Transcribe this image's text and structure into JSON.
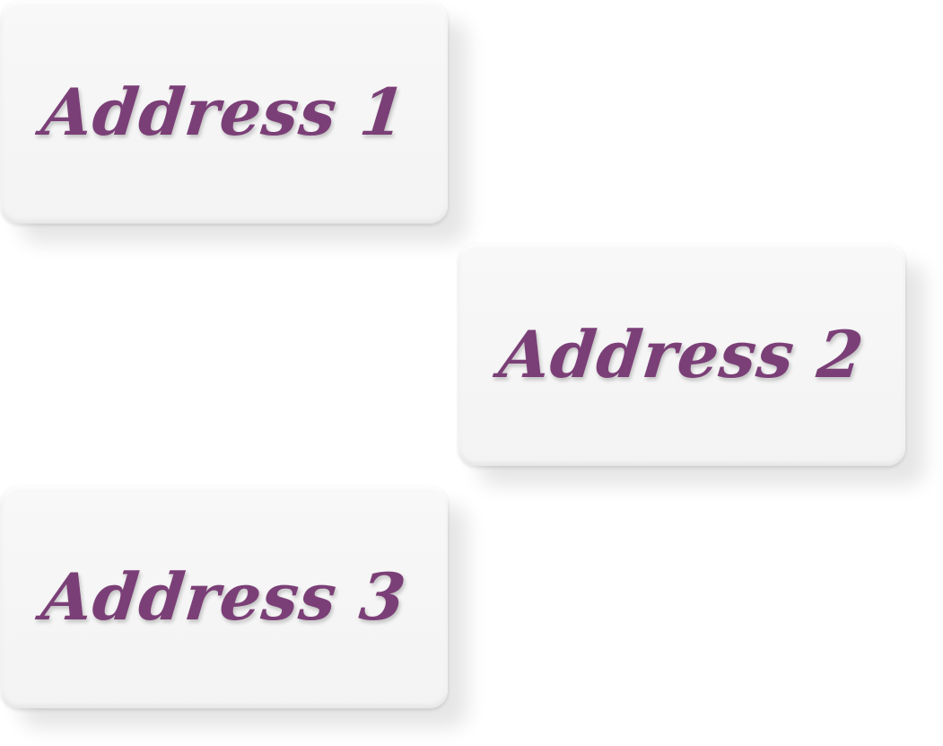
{
  "addresses": [
    {
      "label": "Address 1"
    },
    {
      "label": "Address 2"
    },
    {
      "label": "Address 3"
    }
  ],
  "colors": {
    "label_text": "#7b3f77",
    "card_background": "#f5f5f5",
    "page_background": "#ffffff"
  }
}
